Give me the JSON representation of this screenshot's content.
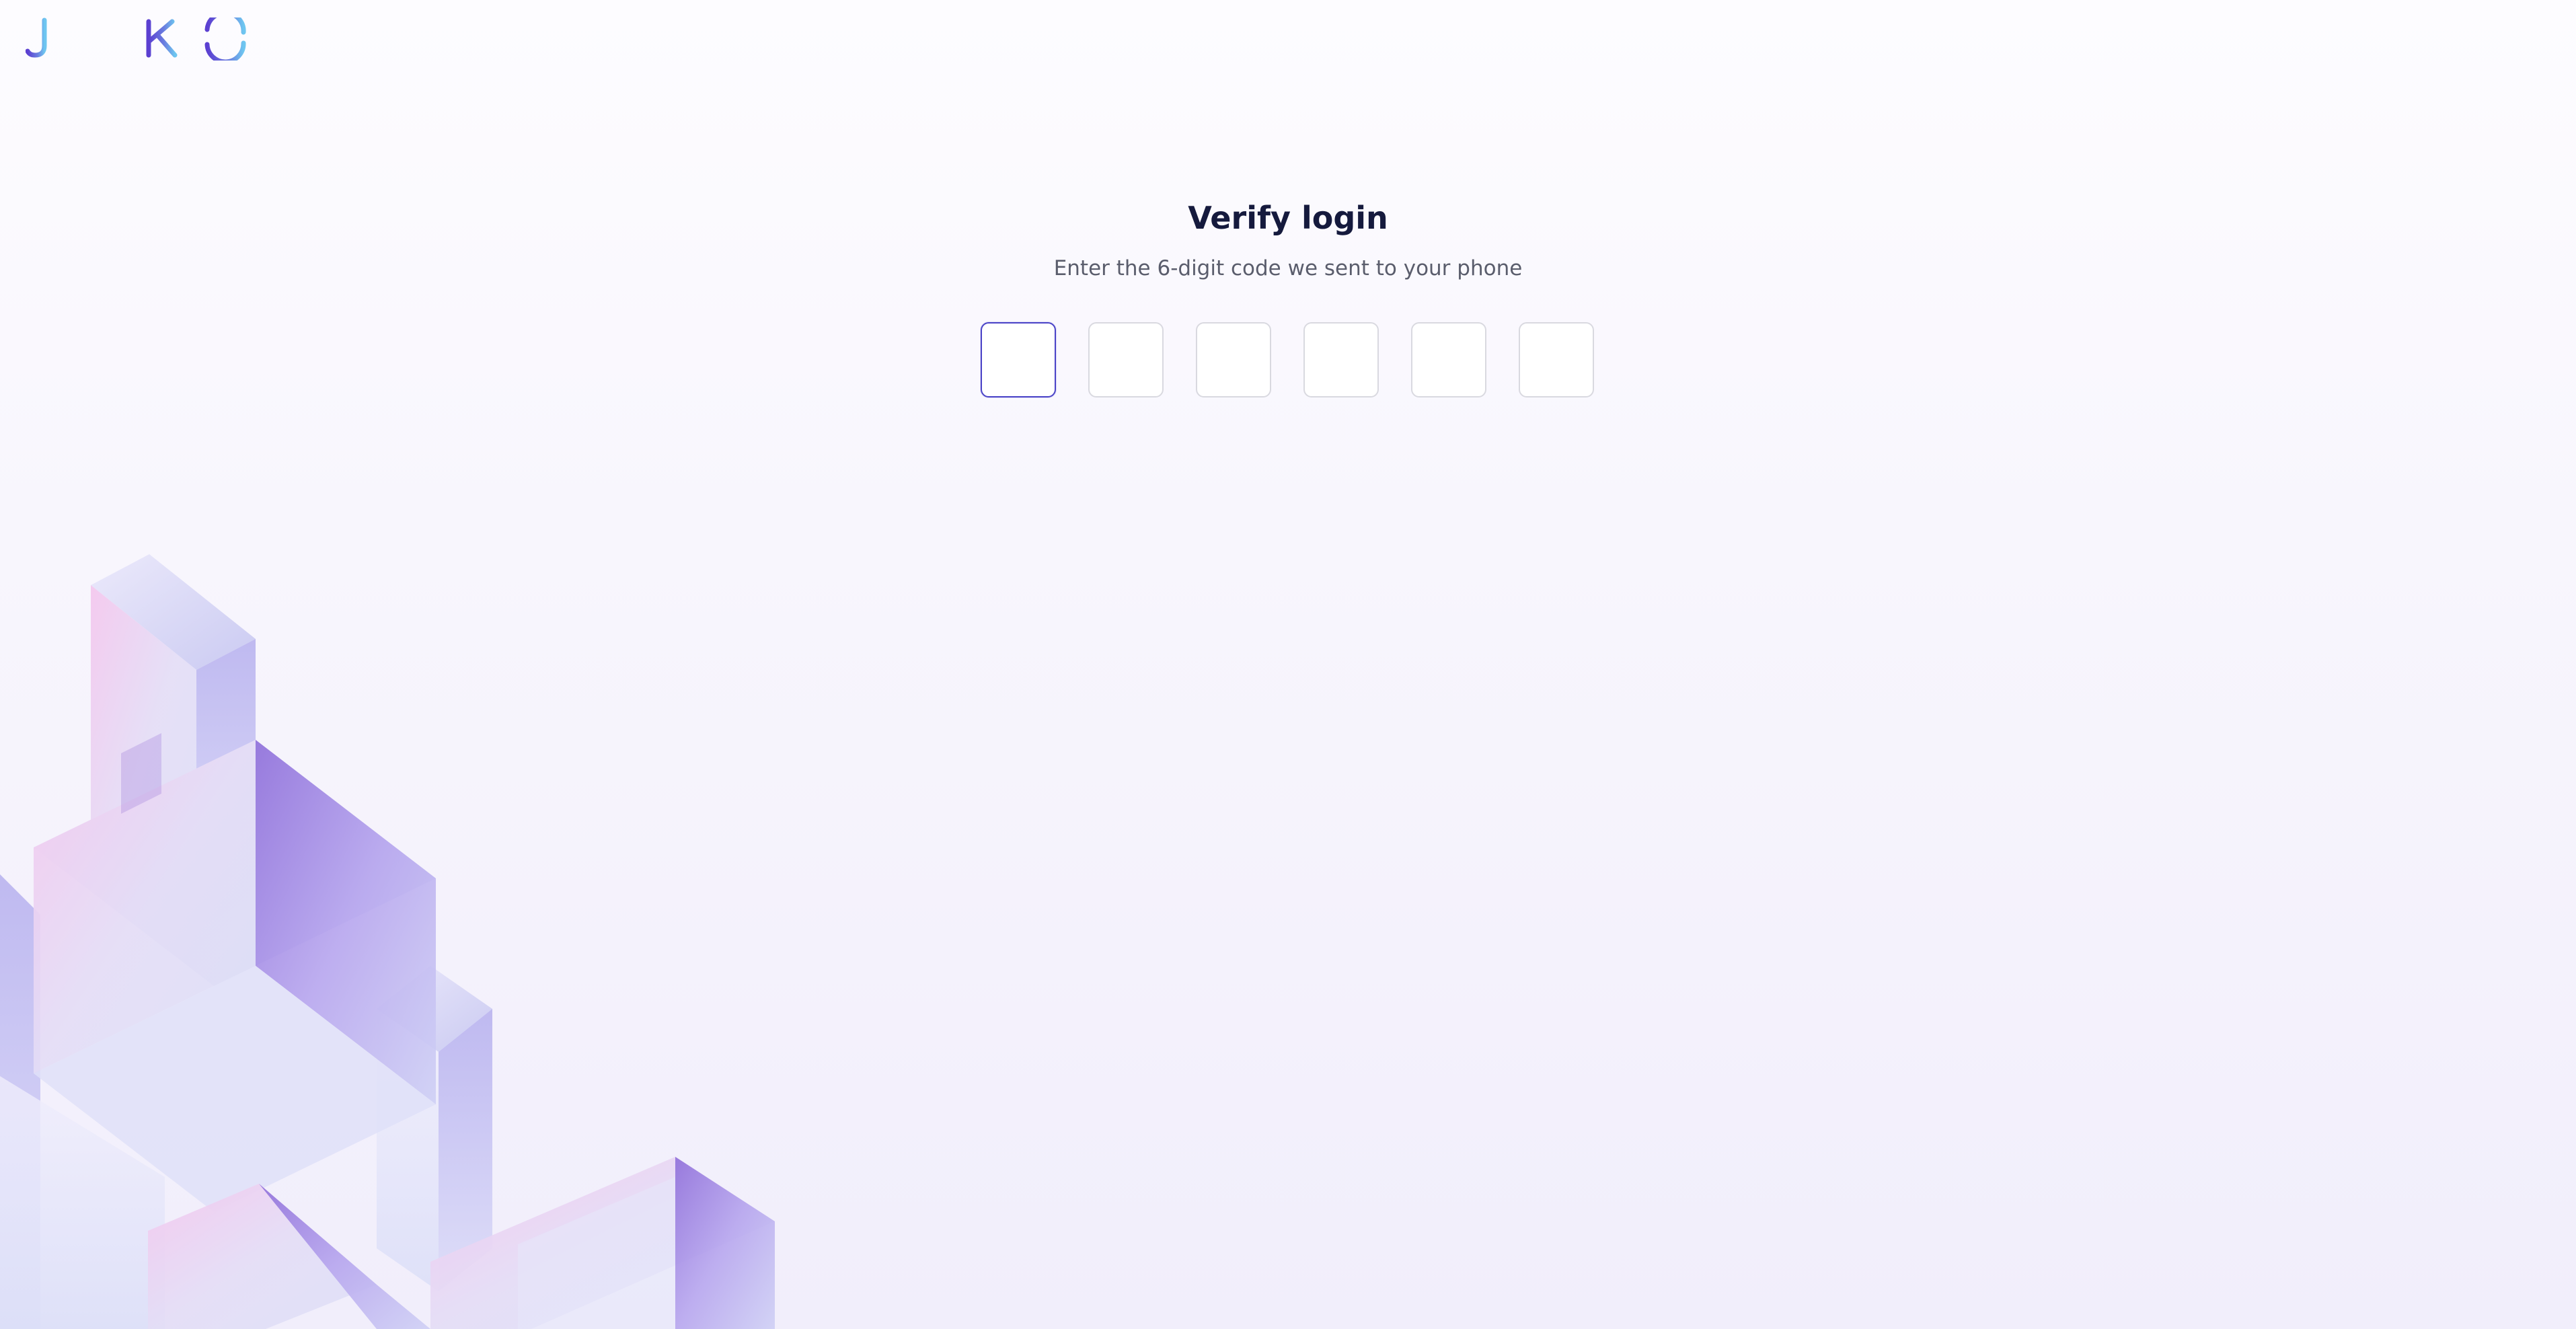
{
  "brand": {
    "name": "JIKO",
    "colors": {
      "logo_start": "#5b3fd1",
      "logo_end": "#6ec6f0",
      "accent": "#4a43c7",
      "title": "#151a3d"
    }
  },
  "verify": {
    "title": "Verify login",
    "subtitle": "Enter the 6-digit code we sent to your phone",
    "code_length": 6,
    "digits": [
      "",
      "",
      "",
      "",
      "",
      ""
    ],
    "active_index": 0
  },
  "decoration": {
    "name": "glass-cubes-illustration",
    "colors": {
      "pink": "#f3c7ec",
      "violet": "#9d7fe0",
      "lavender": "#c9c7f2",
      "pale": "#e8e9fa"
    }
  }
}
